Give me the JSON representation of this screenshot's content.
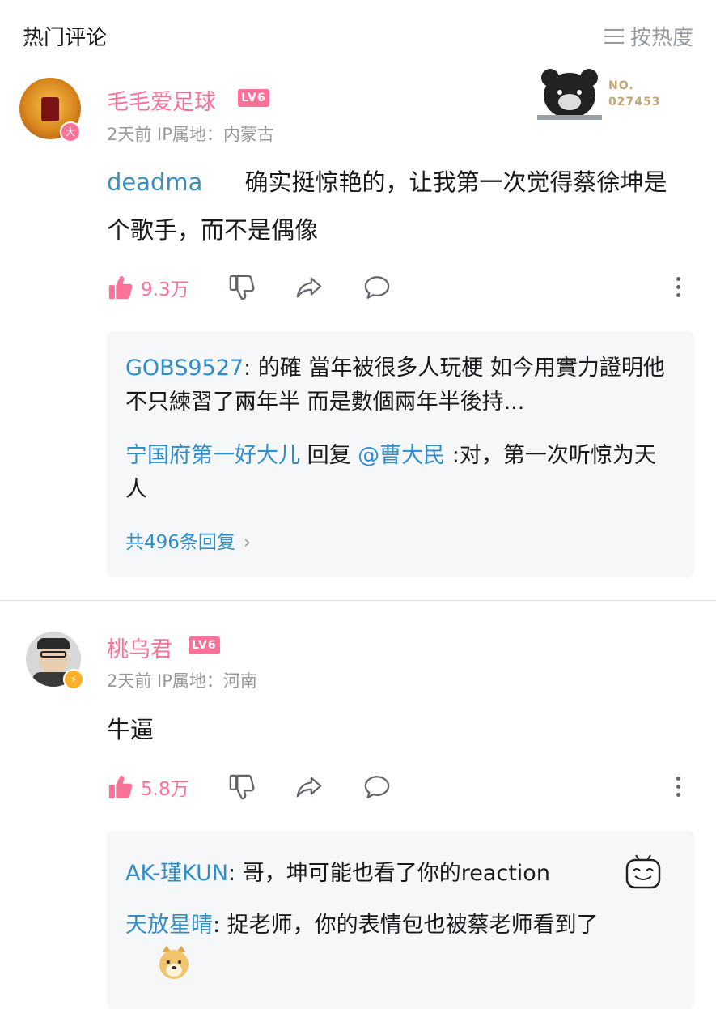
{
  "header": {
    "title": "热门评论",
    "sort_label": "按热度"
  },
  "comments": [
    {
      "username": "毛毛爱足球",
      "level": "LV6",
      "meta": "2天前  IP属地：内蒙古",
      "nft_label": "NO.",
      "nft_number": "027453",
      "content_prefix": "deadma",
      "content": "确实挺惊艳的，让我第一次觉得蔡徐坤是个歌手，而不是偶像",
      "likes": "9.3万",
      "replies": [
        {
          "name": "GOBS9527",
          "text": ": 的確 當年被很多人玩梗 如今用實力證明他不只練習了兩年半 而是數個兩年半後持..."
        },
        {
          "name": "宁国府第一好大儿",
          "mid": " 回复 ",
          "mention": "@曹大民",
          "text": " :对，第一次听惊为天人"
        }
      ],
      "more_replies": "共496条回复"
    },
    {
      "username": "桃乌君",
      "level": "LV6",
      "meta": "2天前  IP属地：河南",
      "content": "牛逼",
      "likes": "5.8万",
      "replies": [
        {
          "name": "AK-瑾KUN",
          "text": ": 哥，坤可能也看了你的reaction"
        },
        {
          "name": "天放星晴",
          "text": ": 捉老师，你的表情包也被蔡老师看到了"
        }
      ]
    }
  ],
  "colors": {
    "accent_pink": "#fb7299",
    "link_blue": "#2f8dca",
    "muted": "#9499a0"
  }
}
